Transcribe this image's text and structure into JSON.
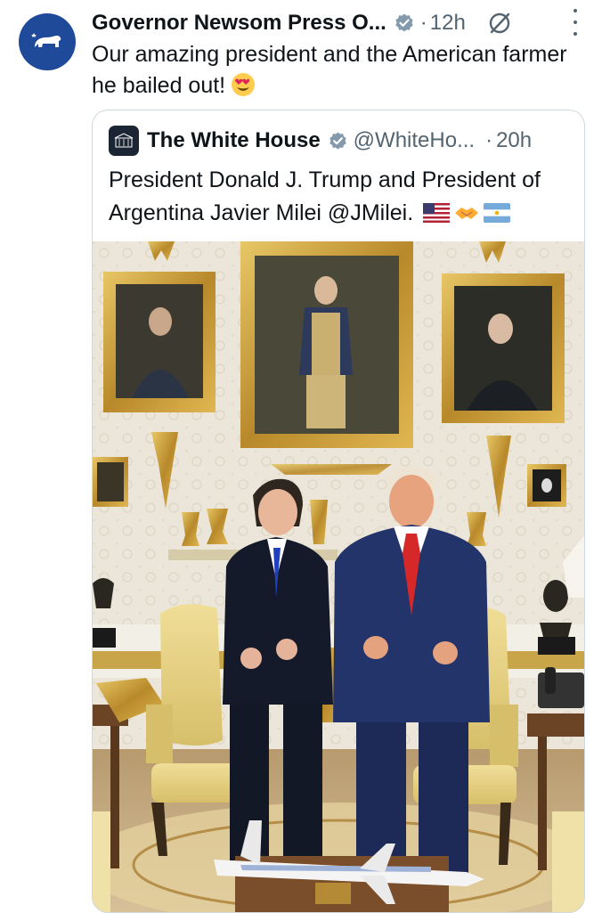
{
  "tweet": {
    "author_name": "Governor Newsom Press O...",
    "time": "12h",
    "separator": "·",
    "text": "Our amazing president and the American farmer he bailed out!",
    "emoji": "smiling-face-with-heart-eyes",
    "avatar_icon": "california-bear-icon"
  },
  "quote": {
    "author_name": "The White House",
    "handle": "@WhiteHo...",
    "separator": "·",
    "time": "20h",
    "text": "President Donald J. Trump and President of Argentina Javier Milei @JMilei.",
    "emojis": [
      "us-flag",
      "handshake",
      "argentina-flag"
    ],
    "image_alt": "Two men giving thumbs up in the Oval Office"
  },
  "colors": {
    "verified_blue": "#1d9bf0",
    "verified_gray": "#829aab",
    "muted_text": "#536471",
    "avatar_bg": "#1f4a99"
  }
}
